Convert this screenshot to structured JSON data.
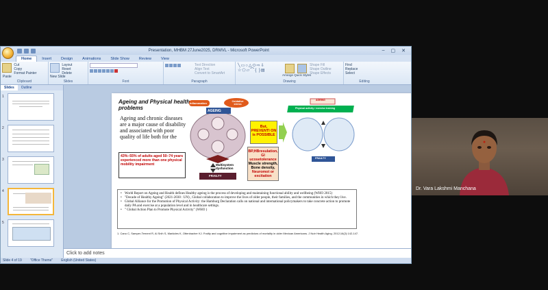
{
  "window": {
    "title": "Presentation, MHBM 27June2025, DRMVL - Microsoft PowerPoint",
    "controls": {
      "minimize": "–",
      "maximize": "▢",
      "close": "✕"
    }
  },
  "ribbon_tabs": [
    "Home",
    "Insert",
    "Design",
    "Animations",
    "Slide Show",
    "Review",
    "View"
  ],
  "ribbon": {
    "clipboard": {
      "label": "Clipboard",
      "paste": "Paste",
      "cut": "Cut",
      "copy": "Copy",
      "format_painter": "Format Painter"
    },
    "slides": {
      "label": "Slides",
      "new_slide": "New Slide",
      "layout": "Layout",
      "reset": "Reset",
      "delete": "Delete"
    },
    "font": {
      "label": "Font"
    },
    "paragraph": {
      "label": "Paragraph",
      "text_direction": "Text Direction",
      "align_text": "Align Text",
      "convert": "Convert to SmartArt"
    },
    "drawing": {
      "label": "Drawing",
      "arrange": "Arrange",
      "quick_styles": "Quick Styles",
      "shape_fill": "Shape Fill",
      "shape_outline": "Shape Outline",
      "shape_effects": "Shape Effects"
    },
    "editing": {
      "label": "Editing",
      "find": "Find",
      "replace": "Replace",
      "select": "Select"
    }
  },
  "panel_tabs": {
    "slides": "Slides",
    "outline": "Outline"
  },
  "thumbnails": [
    "1",
    "2",
    "3",
    "4",
    "5"
  ],
  "slide": {
    "title": "Ageing and Physical health problems",
    "body": "Ageing and chronic diseases are a major cause of disability and associated with poor quality of life both for the",
    "red_box": "43%–55% of adults aged 50–74 years experienced more than one physical mobility impairment",
    "yellow_box": "But, PREVENTI ON is POSSIBLE",
    "peach_red": "BP,HBresulation, Gl ucosetolerance",
    "peach_black1": "Muscle strength, Bone density,",
    "peach_red2": "Neuromot or excitation",
    "diagram_labels": {
      "inflammation": "Inflammation",
      "oxidative": "Oxidative stress",
      "ageing": "AGEING",
      "multisystem": "Multisystem dysfunction",
      "frailty": "FRAILTY",
      "frailty2": "FRAILTY",
      "right_title": "AGEING",
      "right_bar": "Physical activity / exercise training"
    },
    "refs": [
      "World Report on Ageing and Health defines Healthy ageing is the process of developing and maintaining functional ability and wellbeing (WHO 2015)",
      "\"Decade of Healthy Ageing\" (2021-2030 : UN) , Global collaboration to improve the lives of older people, their families, and the communities in which they live.",
      "Global Alliance for the Promotion of Physical Activity: the Hamburg Declaration calls on national and international policymakers to take concrete action to promote daily PA and exercise at a population level and in healthcare settings.",
      "\" Global Action Plan to Promote Physical Activity\" (WHO )"
    ],
    "citation": "1. Cano C, Samper-Ternent R, Al Snih S, Markides K, Ottenbacher KJ. Frailty and cognitive impairment as predictors of mortality in older Mexican Americans. J Nutr Health Aging. 2012;16(2):142-147."
  },
  "notes_placeholder": "Click to add notes",
  "status": {
    "slide": "Slide 4 of 19",
    "theme": "\"Office Theme\"",
    "language": "English (United States)"
  },
  "participant": {
    "name": "Dr. Vara Lakshmi Manchana"
  }
}
